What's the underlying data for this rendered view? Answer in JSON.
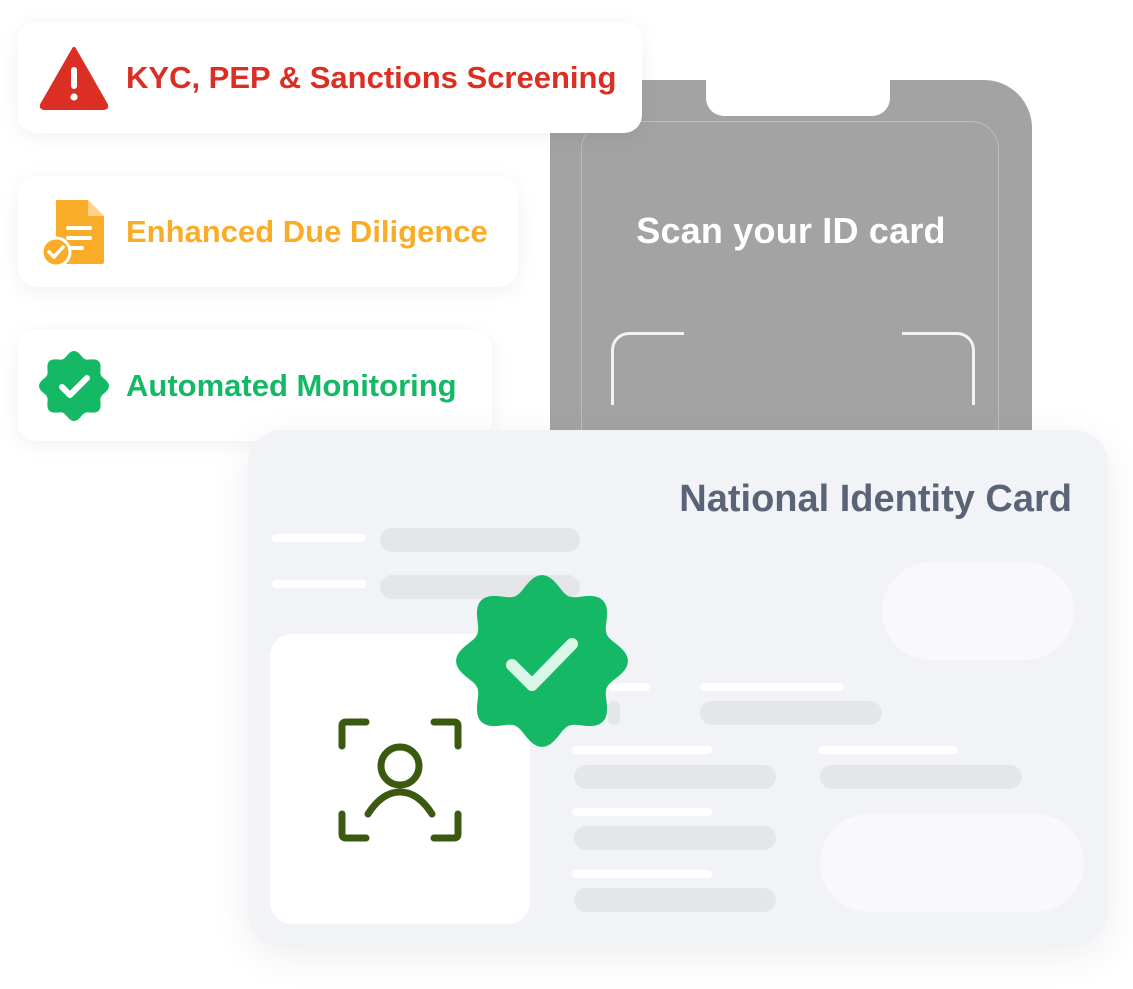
{
  "features": [
    {
      "label": "KYC, PEP & Sanctions Screening",
      "color": "#dc2f23",
      "icon": "warning-triangle-icon"
    },
    {
      "label": "Enhanced Due Diligence",
      "color": "#f9ac27",
      "icon": "document-check-icon"
    },
    {
      "label": "Automated Monitoring",
      "color": "#14b865",
      "icon": "verified-badge-icon"
    }
  ],
  "phone": {
    "scan_title": "Scan your ID card"
  },
  "id_card": {
    "title": "National Identity Card",
    "badge_icon": "verified-badge-icon",
    "photo_icon": "face-scan-icon"
  },
  "colors": {
    "accent_green": "#14b865",
    "face_icon": "#3b5a0f",
    "phone_gray": "#a3a3a3",
    "card_bg": "#f2f3f6",
    "title_gray": "#5b6477"
  }
}
